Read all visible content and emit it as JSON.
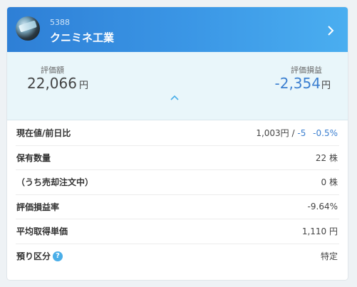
{
  "header": {
    "code": "5388",
    "name": "クニミネ工業"
  },
  "summary": {
    "eval_label": "評価額",
    "eval_value": "22,066",
    "eval_unit": "円",
    "pl_label": "評価損益",
    "pl_value": "-2,354",
    "pl_unit": "円"
  },
  "rows": [
    {
      "label": "現在値/前日比",
      "price": "1,003円 /",
      "change": "-5",
      "change_pct": "-0.5%"
    },
    {
      "label": "保有数量",
      "value": "22 株"
    },
    {
      "label": "（うち売却注文中）",
      "value": "0 株"
    },
    {
      "label": "評価損益率",
      "value": "-9.64%"
    },
    {
      "label": "平均取得単価",
      "value": "1,110 円"
    },
    {
      "label": "預り区分",
      "value": "特定",
      "help": "?"
    }
  ],
  "colors": {
    "accent": "#3b97e6",
    "negative": "#3b7fd0",
    "summary_bg": "#e9f6fa"
  }
}
